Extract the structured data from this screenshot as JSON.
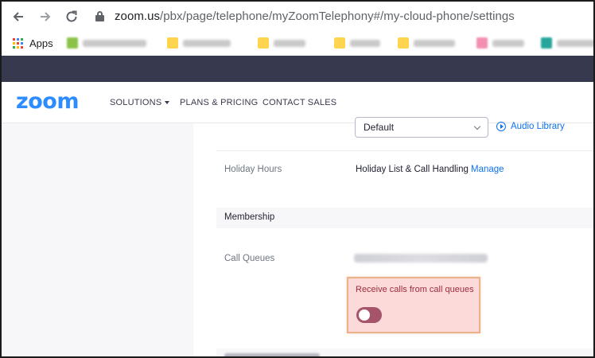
{
  "browser": {
    "url_host": "zoom.us",
    "url_path": "/pbx/page/telephone/myZoomTelephony#/my-cloud-phone/settings",
    "apps_label": "Apps",
    "icons": {
      "back": "arrow-left-icon",
      "forward": "arrow-right-icon",
      "reload": "reload-icon",
      "lock": "lock-icon",
      "apps": "apps-grid-icon"
    }
  },
  "nav": {
    "logo": "zoom",
    "items": [
      {
        "label": "SOLUTIONS"
      },
      {
        "label": "PLANS & PRICING"
      },
      {
        "label": "CONTACT SALES"
      }
    ]
  },
  "settings": {
    "select_value": "Default",
    "audio_library": "Audio Library",
    "holiday_label": "Holiday Hours",
    "holiday_value": "Holiday List & Call Handling",
    "manage_label": "Manage",
    "membership_title": "Membership",
    "call_queues_label": "Call Queues",
    "receive_calls_label": "Receive calls from call queues",
    "receive_calls_enabled": false
  },
  "colors": {
    "zoom_blue": "#2d8cff",
    "link_blue": "#0e72ed",
    "dark_strip": "#373a4f",
    "highlight_bg": "#fddada",
    "highlight_border": "#e9b28a",
    "toggle": "#a6546a"
  }
}
